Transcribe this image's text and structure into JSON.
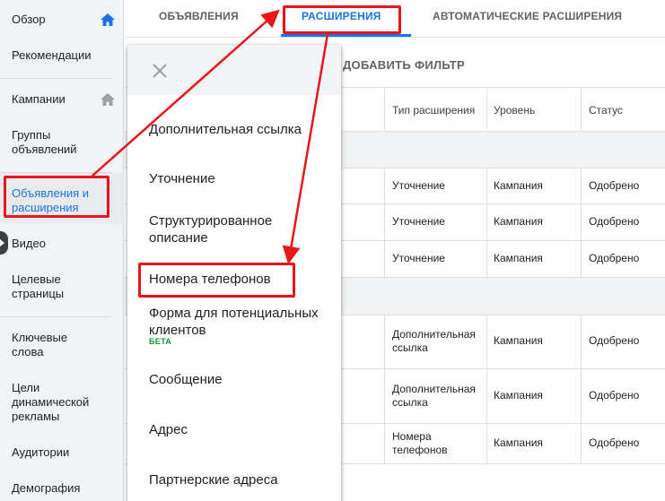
{
  "sidebar": {
    "items": [
      {
        "label": "Обзор"
      },
      {
        "label": "Рекомендации"
      },
      {
        "label": "Кампании"
      },
      {
        "label": "Группы объявлений"
      },
      {
        "label": "Объявления и расширения"
      },
      {
        "label": "Видео"
      },
      {
        "label": "Целевые страницы"
      },
      {
        "label": "Ключевые слова"
      },
      {
        "label": "Цели динамической рекламы"
      },
      {
        "label": "Аудитории"
      },
      {
        "label": "Демография"
      }
    ],
    "active_index": 4
  },
  "tabs": [
    {
      "label": "ОБЪЯВЛЕНИЯ"
    },
    {
      "label": "РАСШИРЕНИЯ"
    },
    {
      "label": "АВТОМАТИЧЕСКИЕ РАСШИРЕНИЯ"
    }
  ],
  "selected_tab": 1,
  "filter": {
    "add_label": "ДОБАВИТЬ ФИЛЬТР"
  },
  "table": {
    "headers": [
      "Тип расширения",
      "Уровень",
      "Статус"
    ],
    "rows": [
      {
        "type": "Уточнение",
        "level": "Кампания",
        "status": "Одобрено"
      },
      {
        "type": "Уточнение",
        "level": "Кампания",
        "status": "Одобрено"
      },
      {
        "type": "Уточнение",
        "level": "Кампания",
        "status": "Одобрено"
      },
      {
        "type": "Дополнительная ссылка",
        "level": "Кампания",
        "status": "Одобрено"
      },
      {
        "type": "Дополнительная ссылка",
        "level": "Кампания",
        "status": "Одобрено"
      },
      {
        "type": "Номера телефонов",
        "level": "Кампания",
        "status": "Одобрено"
      }
    ]
  },
  "dropdown": {
    "close_icon": "close-icon",
    "items": [
      {
        "label": "Дополнительная ссылка"
      },
      {
        "label": "Уточнение"
      },
      {
        "label": "Структурированное описание"
      },
      {
        "label": "Номера телефонов"
      },
      {
        "label": "Форма для потенциальных клиентов",
        "badge": "БЕТА"
      },
      {
        "label": "Сообщение"
      },
      {
        "label": "Адрес"
      },
      {
        "label": "Партнерские адреса"
      }
    ]
  },
  "colors": {
    "accent": "#1a73e8",
    "annotation_red": "#e8151b",
    "beta_green": "#1e8e3e"
  }
}
